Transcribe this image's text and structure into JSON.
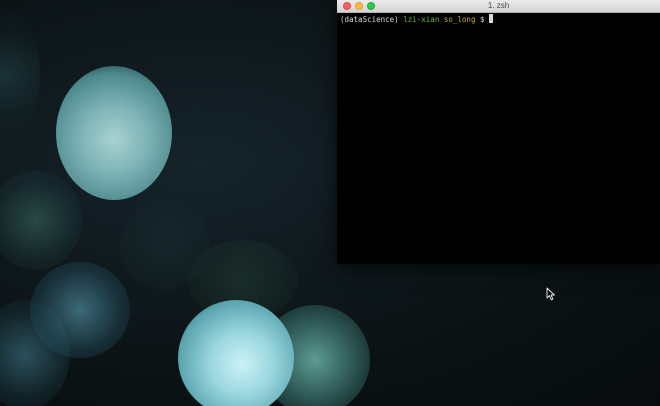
{
  "window": {
    "title": "1. zsh"
  },
  "terminal": {
    "prompt": {
      "env": "(dataScience)",
      "user": "lzi-xian",
      "directory": "so_long",
      "symbol": "$"
    }
  },
  "colors": {
    "prompt_user": "#5fb820",
    "prompt_directory": "#c8a832",
    "terminal_bg": "#000000"
  },
  "icons": {
    "close": "close-icon",
    "minimize": "minimize-icon",
    "maximize": "maximize-icon",
    "pointer": "mouse-pointer-icon"
  }
}
